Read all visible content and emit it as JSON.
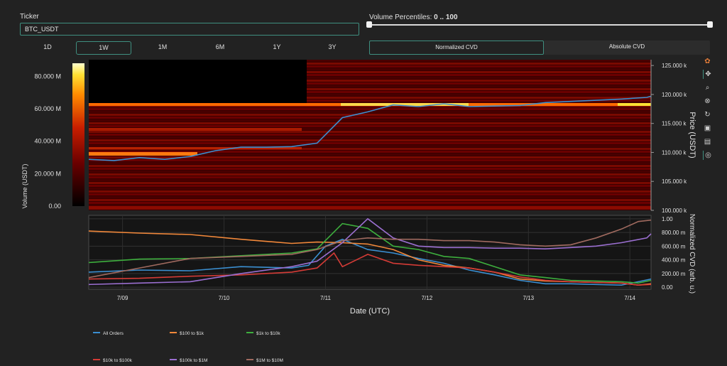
{
  "ticker": {
    "label": "Ticker",
    "value": "BTC_USDT"
  },
  "volume_percentiles": {
    "label": "Volume Percentiles:",
    "range": "0 .. 100",
    "low": 0,
    "high": 100
  },
  "timeframes": [
    "1D",
    "1W",
    "1M",
    "6M",
    "1Y",
    "3Y"
  ],
  "selected_timeframe": "1W",
  "cvd_modes": [
    "Normalized CVD",
    "Absolute CVD"
  ],
  "selected_cvd_mode": "Normalized CVD",
  "toolbar_icons": [
    "plotly-logo-icon",
    "pan-icon",
    "zoom-icon",
    "lasso-icon",
    "reset-icon",
    "download-icon",
    "comment-icon",
    "crosshair-icon"
  ],
  "colors": {
    "background": "#222222",
    "accent": "#3f8f80",
    "price_line": "#3b8fd1"
  },
  "chart_data": [
    {
      "type": "heatmap",
      "title": "",
      "xlabel": "",
      "ylabel": "Price (USDT)",
      "colorbar_label": "Volume (USDT)",
      "colorbar_ticks": [
        "80.000 M",
        "60.000 M",
        "40.000 M",
        "20.000 M",
        "0.00"
      ],
      "colorbar_values": [
        80000000,
        60000000,
        40000000,
        20000000,
        0
      ],
      "y_ticks": [
        "125.000 k",
        "120.000 k",
        "115.000 k",
        "110.000 k",
        "105.000 k",
        "100.000 k"
      ],
      "y_tick_values": [
        125000,
        120000,
        115000,
        110000,
        105000,
        100000
      ],
      "ylim": [
        100000,
        126000
      ],
      "x_range": [
        "7/08 16:00",
        "7/14 05:00"
      ],
      "price_series": {
        "name": "",
        "x_hours": [
          0,
          6,
          12,
          18,
          24,
          30,
          36,
          42,
          48,
          54,
          60,
          66,
          72,
          78,
          84,
          90,
          96,
          102,
          108,
          114,
          120,
          126,
          132,
          133
        ],
        "values": [
          108800,
          108600,
          109100,
          108800,
          109300,
          110300,
          110900,
          110900,
          111000,
          111600,
          116000,
          117000,
          118200,
          117900,
          118400,
          117900,
          118000,
          118100,
          118600,
          118800,
          119000,
          119200,
          119500,
          119700
        ]
      }
    },
    {
      "type": "line",
      "ylabel": "Normalized CVD (arb. u.)",
      "xlabel": "Date (UTC)",
      "x_ticks": [
        "7/09",
        "7/10",
        "7/11",
        "7/12",
        "7/13",
        "7/14"
      ],
      "y_ticks": [
        "1.00",
        "800.00 m",
        "600.00 m",
        "400.00 m",
        "200.00 m",
        "0.00"
      ],
      "y_tick_values": [
        1.0,
        0.8,
        0.6,
        0.4,
        0.2,
        0.0
      ],
      "ylim": [
        -0.03,
        1.05
      ],
      "legend_position": "bottom-left",
      "series": [
        {
          "name": "All Orders",
          "color": "#3b8fd1",
          "x_hours": [
            0,
            12,
            24,
            36,
            48,
            52,
            56,
            60,
            66,
            72,
            78,
            84,
            90,
            96,
            102,
            108,
            114,
            120,
            126,
            130,
            133
          ],
          "values": [
            0.22,
            0.25,
            0.24,
            0.3,
            0.28,
            0.32,
            0.6,
            0.7,
            0.55,
            0.5,
            0.42,
            0.35,
            0.25,
            0.18,
            0.1,
            0.05,
            0.05,
            0.04,
            0.03,
            0.08,
            0.12
          ]
        },
        {
          "name": "$100 to $1k",
          "color": "#f2883a",
          "x_hours": [
            0,
            12,
            24,
            36,
            48,
            54,
            60,
            66,
            72,
            78,
            84,
            90,
            96,
            102,
            108,
            114,
            120,
            126,
            130,
            133
          ],
          "values": [
            0.82,
            0.79,
            0.77,
            0.7,
            0.64,
            0.66,
            0.65,
            0.63,
            0.55,
            0.4,
            0.32,
            0.28,
            0.22,
            0.12,
            0.09,
            0.08,
            0.07,
            0.06,
            0.03,
            0.05
          ]
        },
        {
          "name": "$1k to $10k",
          "color": "#3dae3d",
          "x_hours": [
            0,
            12,
            24,
            36,
            48,
            54,
            60,
            66,
            72,
            78,
            84,
            90,
            96,
            102,
            108,
            114,
            120,
            126,
            130,
            133
          ],
          "values": [
            0.36,
            0.41,
            0.42,
            0.46,
            0.5,
            0.56,
            0.93,
            0.86,
            0.6,
            0.55,
            0.45,
            0.42,
            0.3,
            0.18,
            0.14,
            0.1,
            0.09,
            0.08,
            0.06,
            0.1
          ]
        },
        {
          "name": "$10k to $100k",
          "color": "#d43b36",
          "x_hours": [
            0,
            12,
            24,
            36,
            48,
            54,
            58,
            60,
            66,
            72,
            78,
            84,
            90,
            96,
            102,
            108,
            114,
            120,
            126,
            130,
            133
          ],
          "values": [
            0.12,
            0.13,
            0.16,
            0.18,
            0.22,
            0.28,
            0.5,
            0.3,
            0.48,
            0.35,
            0.32,
            0.3,
            0.28,
            0.22,
            0.15,
            0.1,
            0.08,
            0.07,
            0.06,
            0.03,
            0.04
          ]
        },
        {
          "name": "$100k to $1M",
          "color": "#9b6fd1",
          "x_hours": [
            0,
            12,
            24,
            36,
            48,
            54,
            60,
            66,
            72,
            78,
            84,
            90,
            96,
            102,
            108,
            114,
            120,
            126,
            132,
            133
          ],
          "values": [
            0.04,
            0.06,
            0.08,
            0.2,
            0.3,
            0.38,
            0.65,
            1.0,
            0.72,
            0.6,
            0.58,
            0.58,
            0.57,
            0.57,
            0.56,
            0.58,
            0.6,
            0.65,
            0.72,
            0.78
          ]
        },
        {
          "name": "$1M to $10M",
          "color": "#a06a5f",
          "x_hours": [
            0,
            12,
            24,
            36,
            48,
            54,
            60,
            66,
            72,
            78,
            84,
            90,
            96,
            102,
            108,
            114,
            120,
            126,
            130,
            133
          ],
          "values": [
            0.14,
            0.28,
            0.42,
            0.45,
            0.48,
            0.55,
            0.68,
            0.72,
            0.7,
            0.7,
            0.68,
            0.68,
            0.66,
            0.62,
            0.6,
            0.62,
            0.72,
            0.85,
            0.96,
            0.98
          ]
        }
      ]
    }
  ]
}
